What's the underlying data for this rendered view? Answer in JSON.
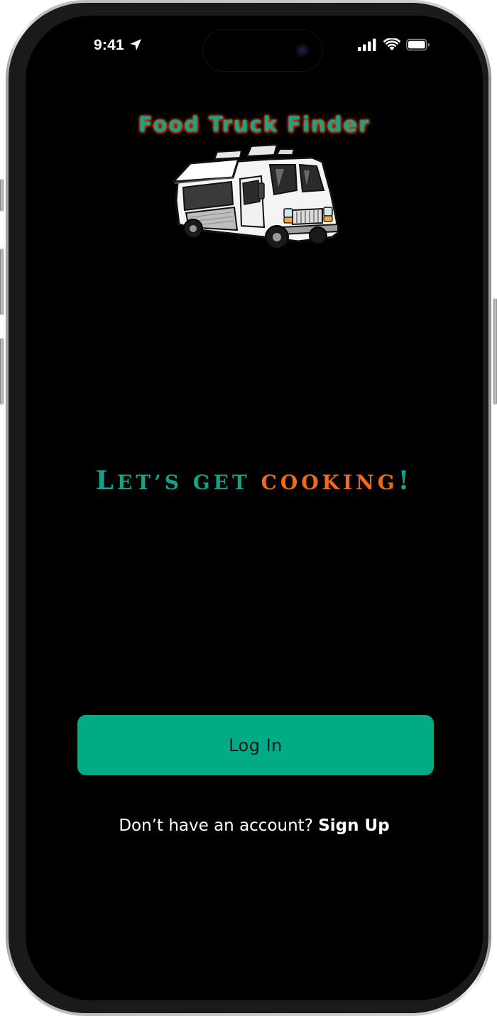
{
  "status_bar": {
    "time": "9:41"
  },
  "icons": {
    "location": "location-arrow-icon",
    "signal": "cellular-signal-icon",
    "wifi": "wifi-icon",
    "battery": "battery-icon"
  },
  "header": {
    "app_title": "Food Truck Finder",
    "logo_image": "food-truck-illustration"
  },
  "headline": {
    "part_green_cap": "L",
    "part_green_small": "et’s get ",
    "part_orange": "cooking",
    "part_green_end": "!"
  },
  "actions": {
    "login_label": "Log In",
    "signup_prompt": "Don’t have an account? ",
    "signup_label": "Sign Up"
  },
  "colors": {
    "background": "#000000",
    "brand_green": "#00ab85",
    "accent_orange": "#f06a1e"
  }
}
